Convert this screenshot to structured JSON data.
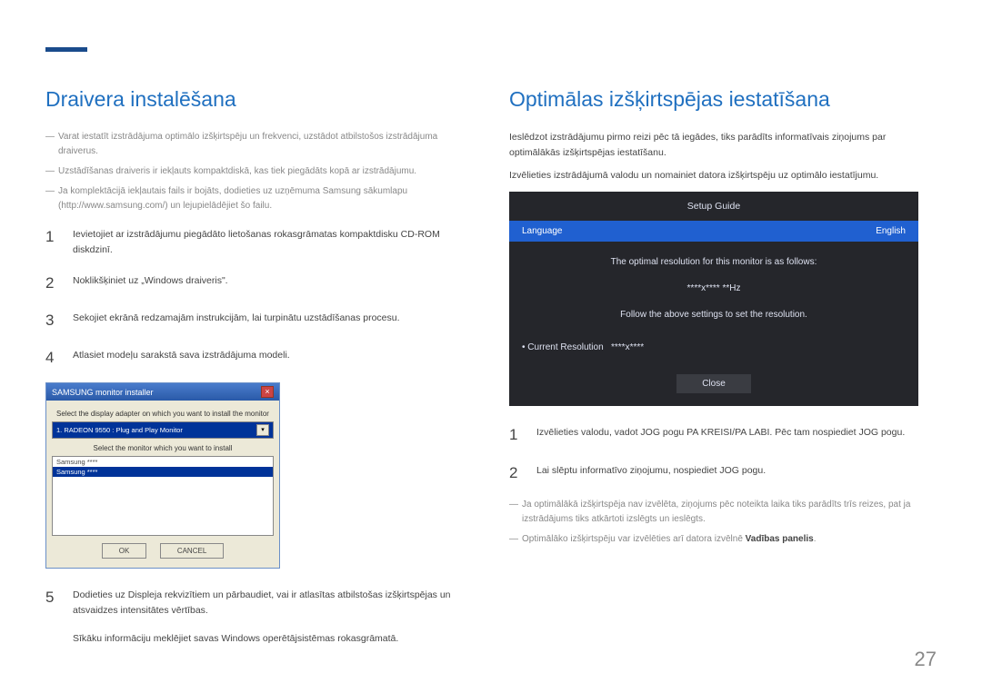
{
  "left": {
    "heading": "Draivera instalēšana",
    "notes": [
      "Varat iestatīt izstrādājuma optimālo izšķirtspēju un frekvenci, uzstādot atbilstošos izstrādājuma draiverus.",
      "Uzstādīšanas draiveris ir iekļauts kompaktdiskā, kas tiek piegādāts kopā ar izstrādājumu.",
      "Ja komplektācijā iekļautais fails ir bojāts, dodieties uz uzņēmuma Samsung sākumlapu (http://www.samsung.com/) un lejupielādējiet šo failu."
    ],
    "steps": [
      "Ievietojiet ar izstrādājumu piegādāto lietošanas rokasgrāmatas kompaktdisku CD-ROM diskdzinī.",
      "Noklikšķiniet uz „Windows draiveris\".",
      "Sekojiet ekrānā redzamajām instrukcijām, lai turpinātu uzstādīšanas procesu.",
      "Atlasiet modeļu sarakstā sava izstrādājuma modeli."
    ],
    "win": {
      "title": "SAMSUNG monitor installer",
      "label1": "Select the display adapter on which you want to install the monitor",
      "adapter": "1. RADEON 9550 : Plug and Play Monitor",
      "label2": "Select the monitor which you want to install",
      "item1": "Samsung ****",
      "item2": "Samsung ****",
      "ok": "OK",
      "cancel": "CANCEL"
    },
    "step5": "Dodieties uz Displeja rekvizītiem un pārbaudiet, vai ir atlasītas atbilstošas izšķirtspējas un atsvaidzes intensitātes vērtības.",
    "foot": "Sīkāku informāciju meklējiet savas Windows operētājsistēmas rokasgrāmatā."
  },
  "right": {
    "heading": "Optimālas izšķirtspējas iestatīšana",
    "intro1": "Ieslēdzot izstrādājumu pirmo reizi pēc tā iegādes, tiks parādīts informatīvais ziņojums par optimālākās izšķirtspējas iestatīšanu.",
    "intro2": "Izvēlieties izstrādājumā valodu un nomainiet datora izšķirtspēju uz optimālo iestatījumu.",
    "osd": {
      "title": "Setup Guide",
      "lang_label": "Language",
      "lang_value": "English",
      "msg1": "The optimal resolution for this monitor is as follows:",
      "res": "****x**** **Hz",
      "msg2": "Follow the above settings to set the resolution.",
      "cur_label": "Current Resolution",
      "cur_value": "****x****",
      "close": "Close"
    },
    "steps": [
      "Izvēlieties valodu, vadot JOG pogu PA KREISI/PA LABI. Pēc tam nospiediet JOG pogu.",
      "Lai slēptu informatīvo ziņojumu, nospiediet JOG pogu."
    ],
    "notes": [
      "Ja optimālākā izšķirtspēja nav izvēlēta, ziņojums pēc noteikta laika tiks parādīts trīs reizes, pat ja izstrādājums tiks atkārtoti izslēgts un ieslēgts.",
      "Optimālāko izšķirtspēju var izvēlēties arī datora izvēlnē "
    ],
    "notes_bold": "Vadības panelis"
  },
  "page_number": "27"
}
